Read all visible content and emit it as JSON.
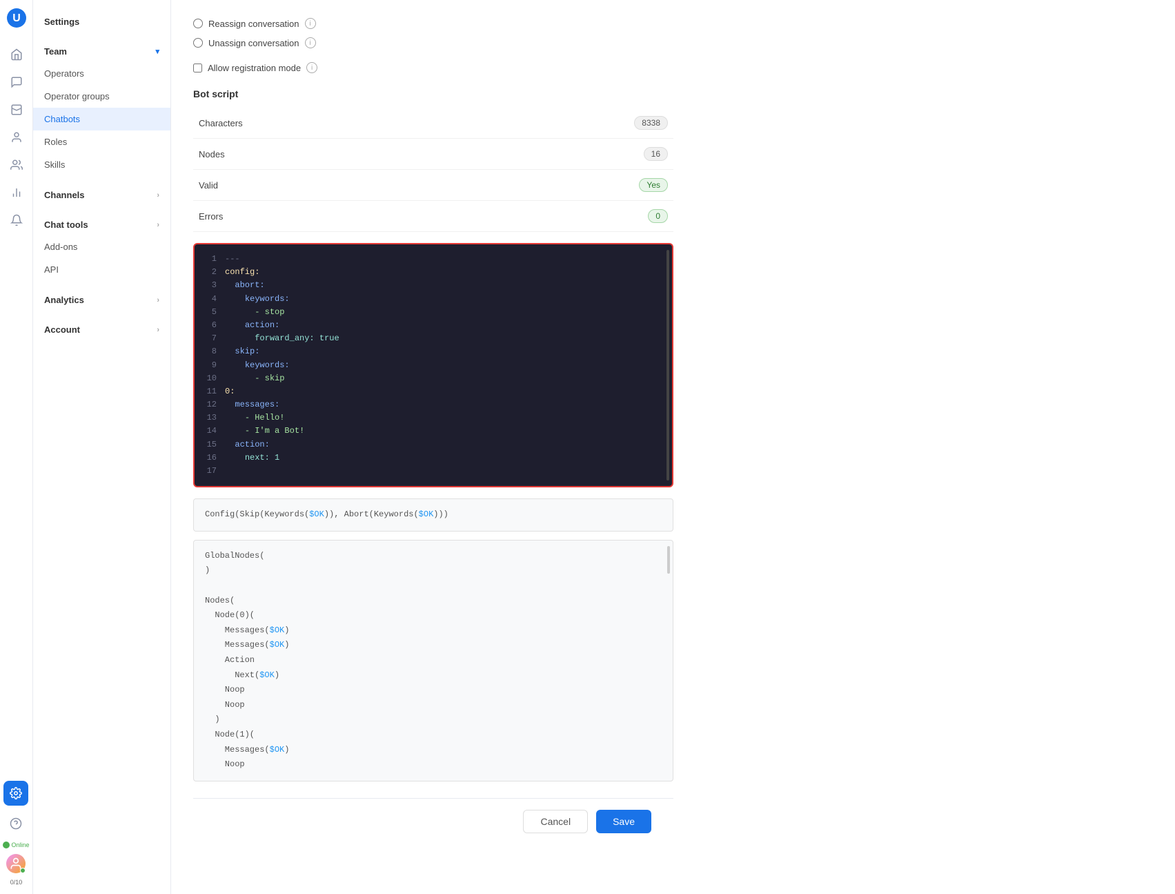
{
  "app": {
    "title": "Settings"
  },
  "sidebar": {
    "title": "Settings",
    "team_section": {
      "label": "Team",
      "expanded": true,
      "items": [
        {
          "id": "operators",
          "label": "Operators",
          "active": false
        },
        {
          "id": "operator-groups",
          "label": "Operator groups",
          "active": false
        },
        {
          "id": "chatbots",
          "label": "Chatbots",
          "active": true
        },
        {
          "id": "roles",
          "label": "Roles",
          "active": false
        },
        {
          "id": "skills",
          "label": "Skills",
          "active": false
        }
      ]
    },
    "channels": {
      "label": "Channels",
      "expanded": false
    },
    "chat_tools": {
      "label": "Chat tools",
      "expanded": false
    },
    "addons": {
      "label": "Add-ons"
    },
    "api": {
      "label": "API"
    },
    "analytics": {
      "label": "Analytics",
      "expanded": false
    },
    "account": {
      "label": "Account",
      "expanded": false
    }
  },
  "nav_icons": [
    {
      "id": "home",
      "icon": "⌂"
    },
    {
      "id": "chat",
      "icon": "💬"
    },
    {
      "id": "inbox",
      "icon": "📥"
    },
    {
      "id": "contacts",
      "icon": "👤"
    },
    {
      "id": "team",
      "icon": "👥"
    },
    {
      "id": "reports",
      "icon": "📊"
    },
    {
      "id": "notifications",
      "icon": "🔔"
    }
  ],
  "main": {
    "options": [
      {
        "id": "reassign",
        "label": "Reassign conversation",
        "checked": false
      },
      {
        "id": "unassign",
        "label": "Unassign conversation",
        "checked": false
      },
      {
        "id": "registration",
        "label": "Allow registration mode",
        "checked": false
      }
    ],
    "bot_script_title": "Bot script",
    "stats": [
      {
        "label": "Characters",
        "value": "8338",
        "type": "badge-gray"
      },
      {
        "label": "Nodes",
        "value": "16",
        "type": "badge-gray"
      },
      {
        "label": "Valid",
        "value": "Yes",
        "type": "badge-green"
      },
      {
        "label": "Errors",
        "value": "0",
        "type": "badge-green-num"
      }
    ],
    "code_lines": [
      {
        "num": 1,
        "content": "---",
        "style": "kw-gray"
      },
      {
        "num": 2,
        "content": "config:",
        "style": "kw-yellow"
      },
      {
        "num": 3,
        "content": "  abort:",
        "style": "kw-blue"
      },
      {
        "num": 4,
        "content": "    keywords:",
        "style": "kw-blue"
      },
      {
        "num": 5,
        "content": "      - stop",
        "style": "kw-green"
      },
      {
        "num": 6,
        "content": "    action:",
        "style": "kw-blue"
      },
      {
        "num": 7,
        "content": "      forward_any: true",
        "style": "kw-teal"
      },
      {
        "num": 8,
        "content": "  skip:",
        "style": "kw-blue"
      },
      {
        "num": 9,
        "content": "    keywords:",
        "style": "kw-blue"
      },
      {
        "num": 10,
        "content": "      - skip",
        "style": "kw-green"
      },
      {
        "num": 11,
        "content": "0:",
        "style": "kw-yellow"
      },
      {
        "num": 12,
        "content": "  messages:",
        "style": "kw-blue"
      },
      {
        "num": 13,
        "content": "    - Hello!",
        "style": "kw-green"
      },
      {
        "num": 14,
        "content": "    - I'm a Bot!",
        "style": "kw-green"
      },
      {
        "num": 15,
        "content": "  action:",
        "style": "kw-blue"
      },
      {
        "num": 16,
        "content": "    next: 1",
        "style": "kw-teal"
      },
      {
        "num": 17,
        "content": "",
        "style": "kw-white"
      }
    ],
    "parsed_line1": "Config(Skip(Keywords($OK)), Abort(Keywords($OK)))",
    "parsed_block": "GlobalNodes(\n)\n\nNodes(\n  Node(0)(\n    Messages($OK)\n    Messages($OK)\n    Action\n      Next($OK)\n    Noop\n    Noop\n  )\n  Node(1)(\n    Messages($OK)\n    Noop",
    "buttons": {
      "cancel": "Cancel",
      "save": "Save"
    }
  },
  "status": {
    "label": "Online",
    "user_count": "0/10"
  }
}
